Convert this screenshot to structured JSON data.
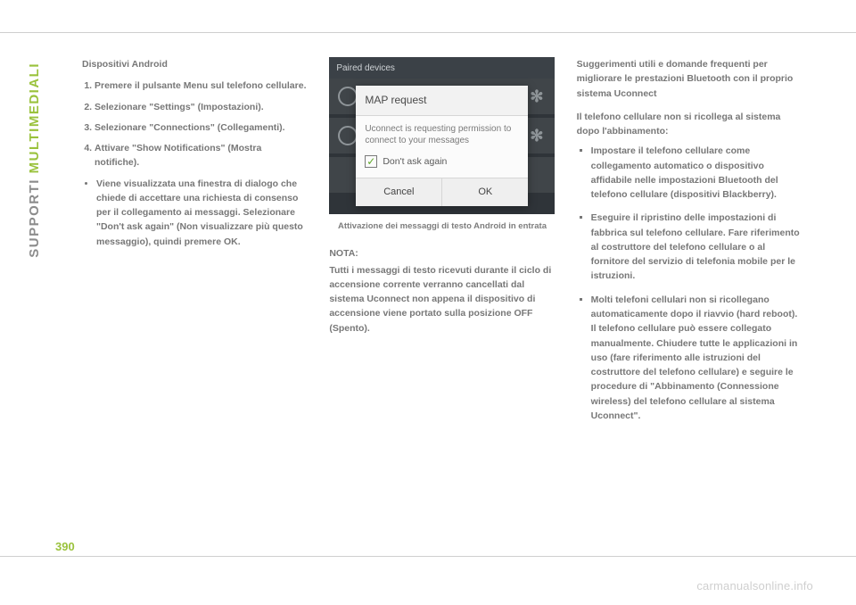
{
  "sidebar": {
    "label_part1": "SUPPORTI ",
    "label_part2": "MULTIMEDIALI"
  },
  "page_number": "390",
  "col1": {
    "heading": "Dispositivi Android",
    "steps": [
      "Premere il pulsante Menu sul telefono cellulare.",
      "Selezionare \"Settings\" (Impostazioni).",
      "Selezionare \"Connections\" (Collegamenti).",
      "Attivare \"Show Notifications\" (Mostra notifiche)."
    ],
    "subbullet": "Viene visualizzata una finestra di dialogo che chiede di accettare una richiesta di consenso per il collegamento ai messaggi. Selezionare \"Don't ask again\" (Non visualizzare più questo messaggio), quindi premere OK."
  },
  "phone": {
    "topbar": "Paired devices",
    "gear": "✻",
    "dialog_title": "MAP request",
    "dialog_msg": "Uconnect is requesting permission to connect to your messages",
    "checkbox_label": "Don't ask again",
    "checkmark": "✓",
    "btn_cancel": "Cancel",
    "btn_ok": "OK"
  },
  "caption": "Attivazione dei messaggi di testo Android in entrata",
  "note": {
    "label": "NOTA:",
    "text": "Tutti i messaggi di testo ricevuti durante il ciclo di accensione corrente verranno cancellati dal sistema Uconnect non appena il dispositivo di accensione viene portato sulla posizione OFF (Spento)."
  },
  "col3": {
    "tips_heading": "Suggerimenti utili e domande frequenti per migliorare le prestazioni Bluetooth con il proprio sistema Uconnect",
    "subheading": "Il telefono cellulare non si ricollega al sistema dopo l'abbinamento:",
    "bullets": [
      "Impostare il telefono cellulare come collegamento automatico o dispositivo affidabile nelle impostazioni Bluetooth del telefono cellulare (dispositivi Blackberry).",
      "Eseguire il ripristino delle impostazioni di fabbrica sul telefono cellulare. Fare riferimento al costruttore del telefono cellulare o al fornitore del servizio di telefonia mobile per le istruzioni.",
      "Molti telefoni cellulari non si ricollegano automaticamente dopo il riavvio (hard reboot). Il telefono cellulare può essere collegato manualmente. Chiudere tutte le applicazioni in uso (fare riferimento alle istruzioni del costruttore del telefono cellulare) e seguire le procedure di \"Abbinamento (Connessione wireless) del telefono cellulare al sistema Uconnect\"."
    ]
  },
  "watermark": "carmanualsonline.info"
}
